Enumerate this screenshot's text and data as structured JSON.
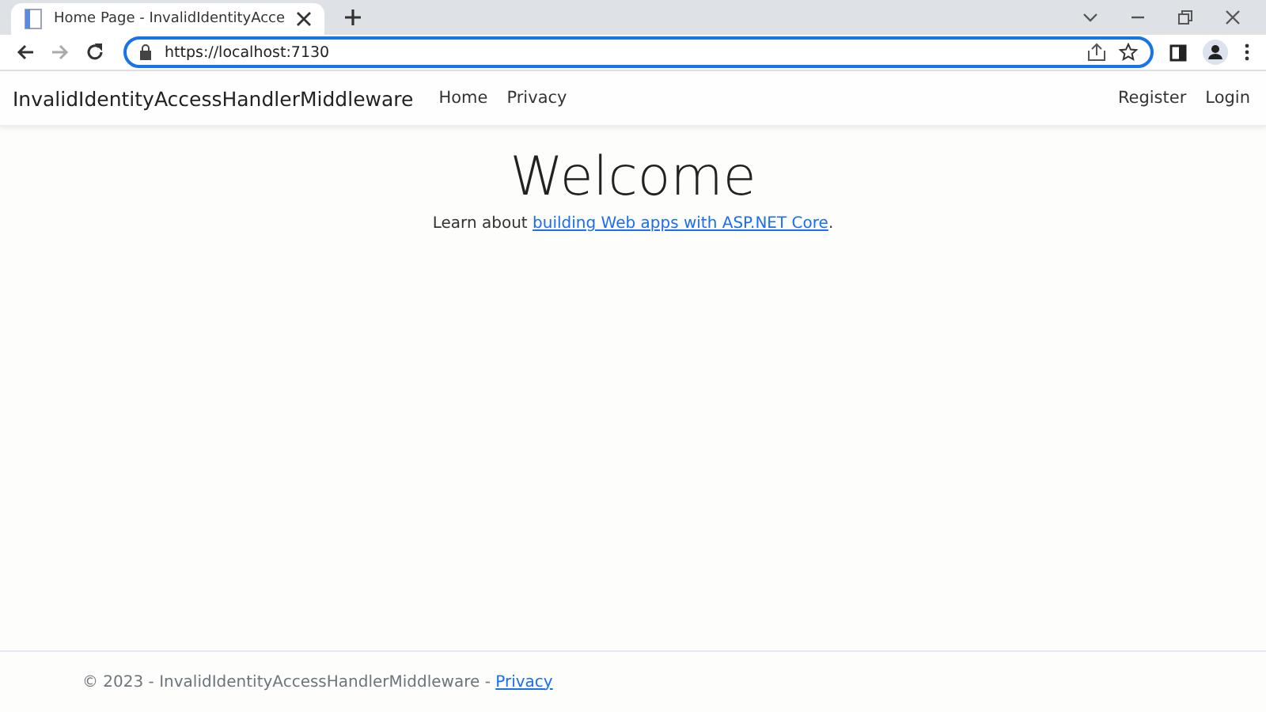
{
  "browser": {
    "tab": {
      "title": "Home Page - InvalidIdentityAcce",
      "selected": true
    },
    "address": "https://localhost:7130"
  },
  "navbar": {
    "brand": "InvalidIdentityAccessHandlerMiddleware",
    "links": [
      "Home",
      "Privacy"
    ],
    "account_links": [
      "Register",
      "Login"
    ]
  },
  "main": {
    "heading": "Welcome",
    "lead": "Learn about ",
    "link": "building Web apps with ASP.NET Core",
    "after": "."
  },
  "footer": {
    "text": "© 2023 - InvalidIdentityAccessHandlerMiddleware - ",
    "link": "Privacy"
  }
}
